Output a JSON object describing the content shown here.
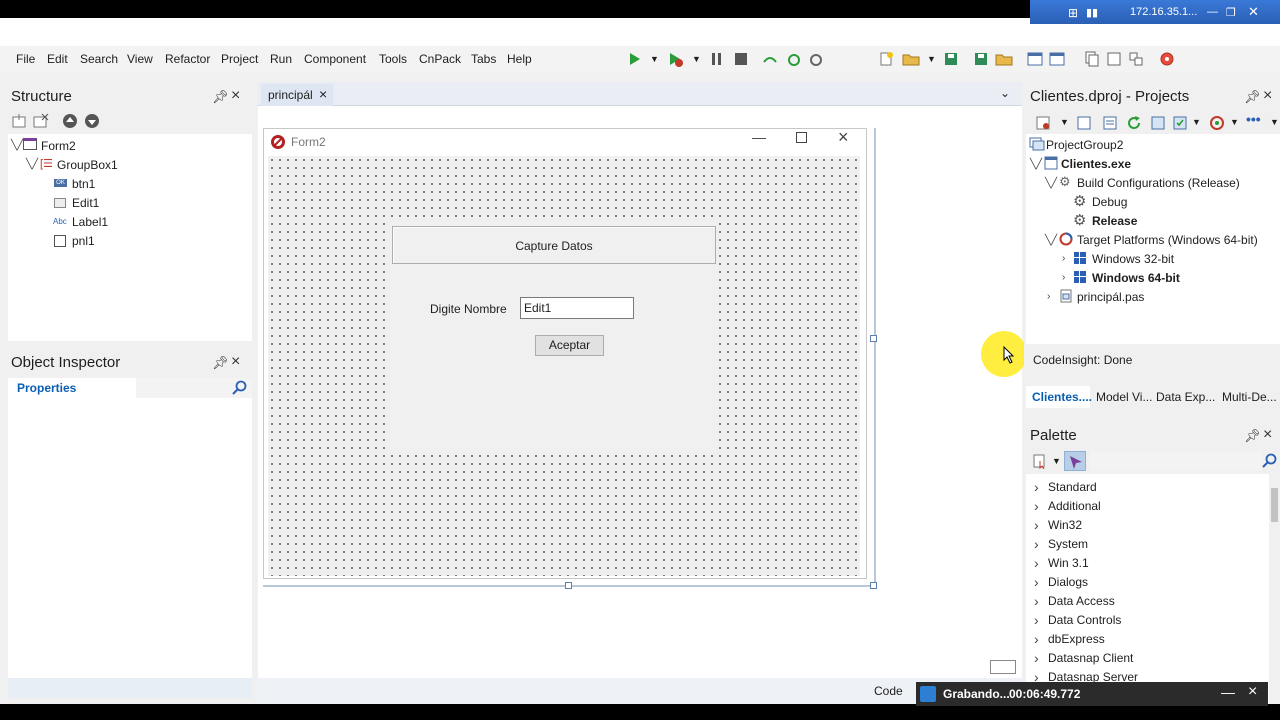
{
  "rdbar": {
    "ip": "172.16.35.1..."
  },
  "menu": [
    "File",
    "Edit",
    "Search",
    "View",
    "Refactor",
    "Project",
    "Run",
    "Component",
    "Tools",
    "CnPack",
    "Tabs",
    "Help"
  ],
  "structure": {
    "title": "Structure",
    "items": [
      {
        "label": "Form2"
      },
      {
        "label": "GroupBox1"
      },
      {
        "label": "btn1"
      },
      {
        "label": "Edit1"
      },
      {
        "label": "Label1"
      },
      {
        "label": "pnl1"
      }
    ],
    "icon_label_abc": "Abc",
    "icon_label_ok": "OK"
  },
  "inspector": {
    "title": "Object Inspector",
    "tab": "Properties"
  },
  "editor": {
    "tab": "principál",
    "form_title": "Form2",
    "group_caption": "Capture Datos",
    "label": "Digite Nombre",
    "edit_value": "Edit1",
    "button": "Aceptar",
    "code_tab": "Code"
  },
  "projects": {
    "title": "Clientes.dproj - Projects",
    "items": [
      {
        "label": "ProjectGroup2"
      },
      {
        "label": "Clientes.exe"
      },
      {
        "label": "Build Configurations (Release)"
      },
      {
        "label": "Debug"
      },
      {
        "label": "Release"
      },
      {
        "label": "Target Platforms (Windows 64-bit)"
      },
      {
        "label": "Windows 32-bit"
      },
      {
        "label": "Windows 64-bit"
      },
      {
        "label": "principál.pas"
      }
    ],
    "status": "CodeInsight: Done",
    "tabs": [
      "Clientes....",
      "Model Vi...",
      "Data Exp...",
      "Multi-De..."
    ]
  },
  "palette": {
    "title": "Palette",
    "items": [
      "Standard",
      "Additional",
      "Win32",
      "System",
      "Win 3.1",
      "Dialogs",
      "Data Access",
      "Data Controls",
      "dbExpress",
      "Datasnap Client",
      "Datasnap Server"
    ]
  },
  "recorder": {
    "label": "Grabando...",
    "time": "00:06:49.772"
  },
  "colors": {
    "accent": "#0a5fb4",
    "selection": "#cce4f7",
    "panel": "#f0f0f0"
  }
}
